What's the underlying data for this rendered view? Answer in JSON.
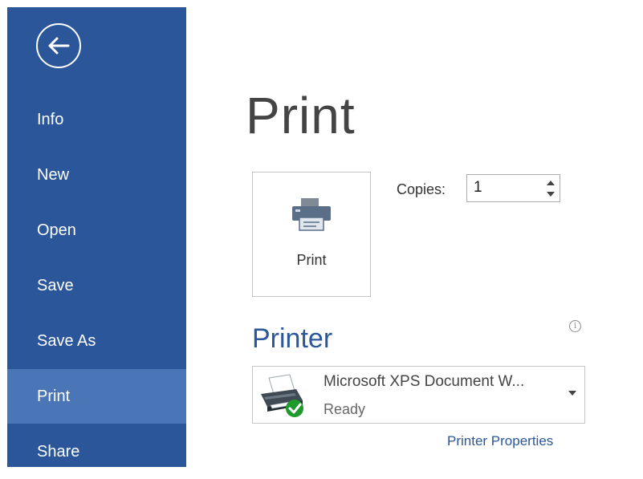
{
  "colors": {
    "accent": "#2b579a",
    "sidebar_active": "#4a76b8",
    "status_ok": "#1e9b2c"
  },
  "icons": {
    "back": "back-arrow-icon",
    "print": "printer-icon",
    "info": "info-icon",
    "printer_device": "printer-ready-icon",
    "dropdown": "chevron-down-icon"
  },
  "sidebar": {
    "items": [
      {
        "label": "Info"
      },
      {
        "label": "New"
      },
      {
        "label": "Open"
      },
      {
        "label": "Save"
      },
      {
        "label": "Save As"
      },
      {
        "label": "Print",
        "active": true
      },
      {
        "label": "Share"
      }
    ]
  },
  "main": {
    "title": "Print",
    "print_button_label": "Print",
    "copies": {
      "label": "Copies:",
      "value": "1"
    },
    "printer": {
      "heading": "Printer",
      "name": "Microsoft XPS Document W...",
      "status": "Ready",
      "properties_link": "Printer Properties"
    }
  }
}
